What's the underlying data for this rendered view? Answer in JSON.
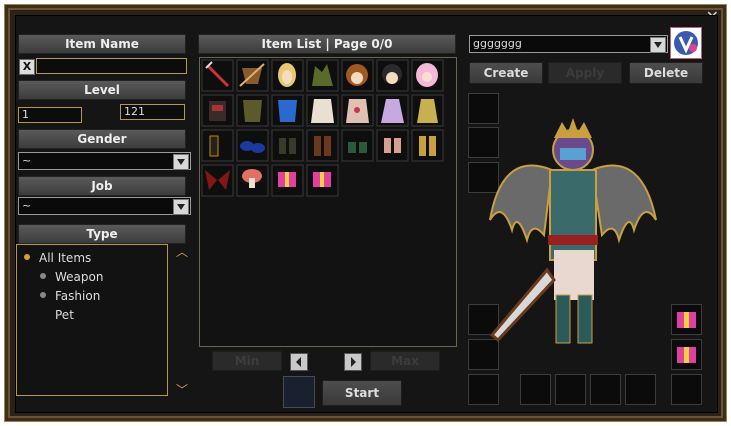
{
  "close_label": "✕",
  "left": {
    "item_name": {
      "header": "Item Name",
      "clear": "X",
      "value": ""
    },
    "level": {
      "header": "Level",
      "min": "1",
      "max": "121"
    },
    "gender": {
      "header": "Gender",
      "selected": "~"
    },
    "job": {
      "header": "Job",
      "selected": "~"
    },
    "type": {
      "header": "Type",
      "items": [
        "All Items",
        "Weapon",
        "Fashion",
        "Pet"
      ]
    }
  },
  "center": {
    "header": "Item List | Page 0/0",
    "icons": [
      [
        "sword-icon",
        "crossbow-icon",
        "blonde-hair-icon",
        "green-helmet-icon",
        "brown-hair-icon",
        "black-hair-icon",
        "pink-hair-icon"
      ],
      [
        "dark-armor-icon",
        "green-armor-icon",
        "blue-top-icon",
        "white-robe-icon",
        "patterned-robe-icon",
        "lavender-dress-icon",
        "yellow-dress-icon"
      ],
      [
        "black-gloves-icon",
        "blue-gloves-icon",
        "dark-boots-icon",
        "brown-boots-icon",
        "green-boots-icon",
        "pink-shoes-icon",
        "yellow-boots-icon"
      ],
      [
        "red-wings-icon",
        "mushroom-pet-icon",
        "gift-box-icon",
        "gift-box-icon"
      ]
    ],
    "min_label": "Min",
    "max_label": "Max",
    "start_label": "Start"
  },
  "right": {
    "character_name": "ggggggg",
    "create_label": "Create",
    "apply_label": "Apply",
    "delete_label": "Delete"
  },
  "colors": {
    "accent": "#b59a45",
    "frame": "#6b5330"
  }
}
